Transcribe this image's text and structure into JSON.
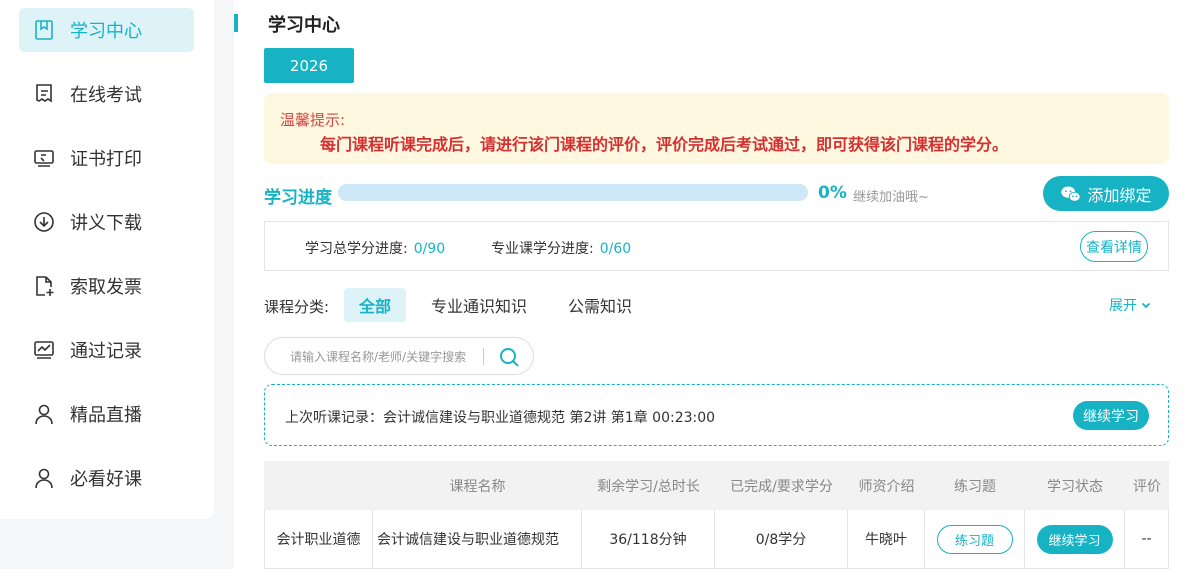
{
  "sidebar": {
    "items": [
      {
        "label": "学习中心",
        "icon": "bookmark-icon"
      },
      {
        "label": "在线考试",
        "icon": "document-icon"
      },
      {
        "label": "证书打印",
        "icon": "print-certificate-icon"
      },
      {
        "label": "讲义下载",
        "icon": "download-icon"
      },
      {
        "label": "索取发票",
        "icon": "add-file-icon"
      },
      {
        "label": "通过记录",
        "icon": "chart-record-icon"
      },
      {
        "label": "精品直播",
        "icon": "user-icon"
      },
      {
        "label": "必看好课",
        "icon": "user-icon"
      }
    ]
  },
  "header": {
    "title": "学习中心",
    "year_tab": "2026"
  },
  "notice": {
    "title": "温馨提示:",
    "body": "每门课程听课完成后，请进行该门课程的评价，评价完成后考试通过，即可获得该门课程的学分。"
  },
  "progress": {
    "label": "学习进度",
    "percent_text": "0%",
    "percent_value": 0,
    "hint": "继续加油哦~",
    "bind_button": "添加绑定"
  },
  "credits": {
    "total_label": "学习总学分进度:",
    "total_value": "0/90",
    "major_label": "专业课学分进度:",
    "major_value": "0/60",
    "detail_button": "查看详情"
  },
  "categories": {
    "label": "课程分类:",
    "tabs": [
      "全部",
      "专业通识知识",
      "公需知识"
    ],
    "expand": "展开"
  },
  "search": {
    "placeholder": "请输入课程名称/老师/关键字搜索"
  },
  "last_record": {
    "text": "上次听课记录：会计诚信建设与职业道德规范 第2讲 第1章 00:23:00",
    "button": "继续学习"
  },
  "table": {
    "headers": [
      "",
      "课程名称",
      "剩余学习/总时长",
      "已完成/要求学分",
      "师资介绍",
      "练习题",
      "学习状态",
      "评价"
    ],
    "rows": [
      {
        "category": "会计职业道德",
        "name": "会计诚信建设与职业道德规范",
        "duration": "36/118分钟",
        "credits": "0/8学分",
        "teacher": "牛晓叶",
        "exercise": "练习题",
        "status": "继续学习",
        "rating": "--"
      }
    ]
  },
  "colors": {
    "accent": "#17b3c5",
    "notice_bg": "#fff8e1",
    "notice_text": "#d43030"
  }
}
